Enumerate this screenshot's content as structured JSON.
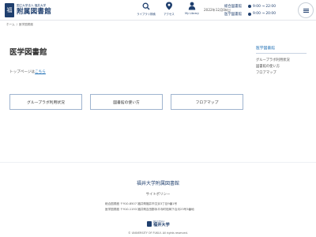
{
  "header": {
    "logo": {
      "sub": "国立大学法人 福井大学",
      "main": "附属図書館"
    },
    "nav": [
      {
        "label": "ライブラリ検索",
        "icon": "search-icon"
      },
      {
        "label": "アクセス",
        "icon": "map-pin-icon"
      },
      {
        "label": "My Library",
        "icon": "user-icon"
      }
    ],
    "date": "2022年12月08日",
    "hours": [
      {
        "label": "総合図書館",
        "time": "9:00 → 22:00"
      },
      {
        "label": "医学図書館",
        "time": "9:00 → 20:00"
      }
    ],
    "menu_icon": "hamburger-icon"
  },
  "breadcrumb": {
    "home": "ホーム",
    "separator": "/",
    "current": "医学図書館"
  },
  "main": {
    "title": "医学図書館",
    "top_link_prefix": "トップページは",
    "top_link_text": "こちら",
    "buttons": [
      {
        "label": "グループラボ利用状況"
      },
      {
        "label": "図書館の使い方"
      },
      {
        "label": "フロアマップ"
      }
    ]
  },
  "sidebar": {
    "heading": "医学図書館",
    "items": [
      {
        "label": "グループラボ利用状況"
      },
      {
        "label": "図書館の使い方"
      },
      {
        "label": "フロアマップ"
      }
    ]
  },
  "footer": {
    "title": "福井大学附属図書館",
    "policy": "サイトポリシー",
    "addresses": [
      "総合図書館 〒910-8507 福井県福井市文京3丁目9番1号",
      "医学図書館 〒910-1193 福井県吉田郡永平寺町松岡下合月23号3番地"
    ],
    "logo_sub": "国立大学法人",
    "logo_main": "福井大学",
    "copyright": "© UNIVERSITY OF FUKUI. All rights reserved."
  },
  "colors": {
    "brand": "#1f3f6e",
    "link": "#1f6fb5",
    "button_border": "#9fb4cf"
  }
}
